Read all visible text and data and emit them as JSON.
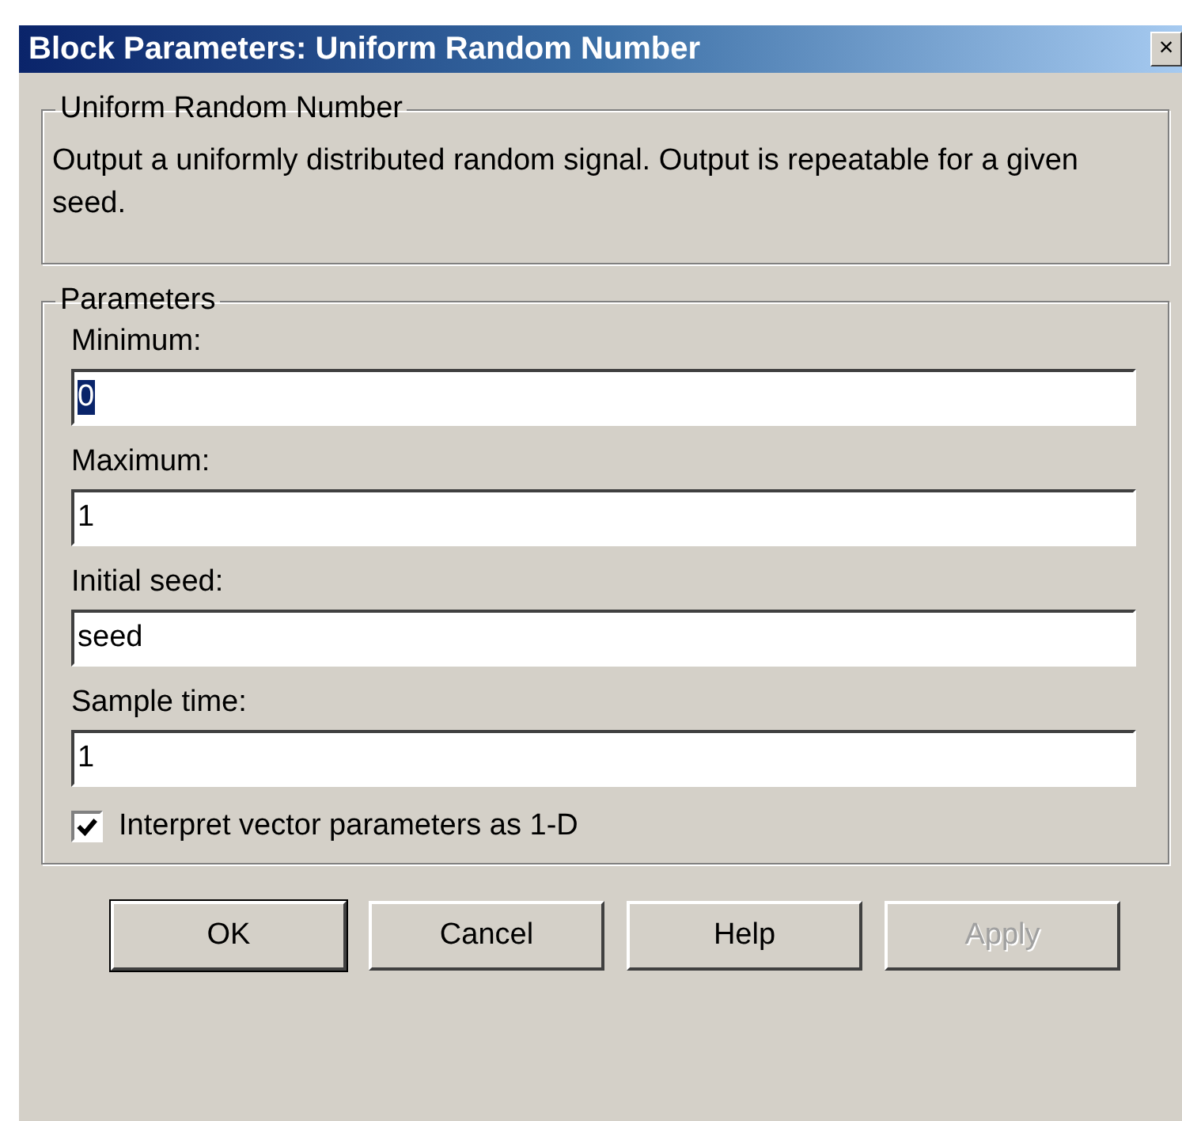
{
  "window": {
    "title": "Block Parameters: Uniform Random Number",
    "close_label": "×"
  },
  "description": {
    "title": "Uniform Random Number",
    "text": "Output a uniformly distributed random signal.  Output is repeatable for a given seed."
  },
  "parameters": {
    "title": "Parameters",
    "fields": [
      {
        "label": "Minimum:",
        "value": "0",
        "text_selected": true
      },
      {
        "label": "Maximum:",
        "value": "1",
        "text_selected": false
      },
      {
        "label": "Initial seed:",
        "value": "seed",
        "text_selected": false
      },
      {
        "label": "Sample time:",
        "value": "1",
        "text_selected": false
      }
    ],
    "checkbox": {
      "label": "Interpret vector parameters as 1-D",
      "checked": true
    }
  },
  "buttons": [
    {
      "label": "OK",
      "default": true,
      "disabled": false
    },
    {
      "label": "Cancel",
      "default": false,
      "disabled": false
    },
    {
      "label": "Help",
      "default": false,
      "disabled": false
    },
    {
      "label": "Apply",
      "default": false,
      "disabled": true
    }
  ]
}
